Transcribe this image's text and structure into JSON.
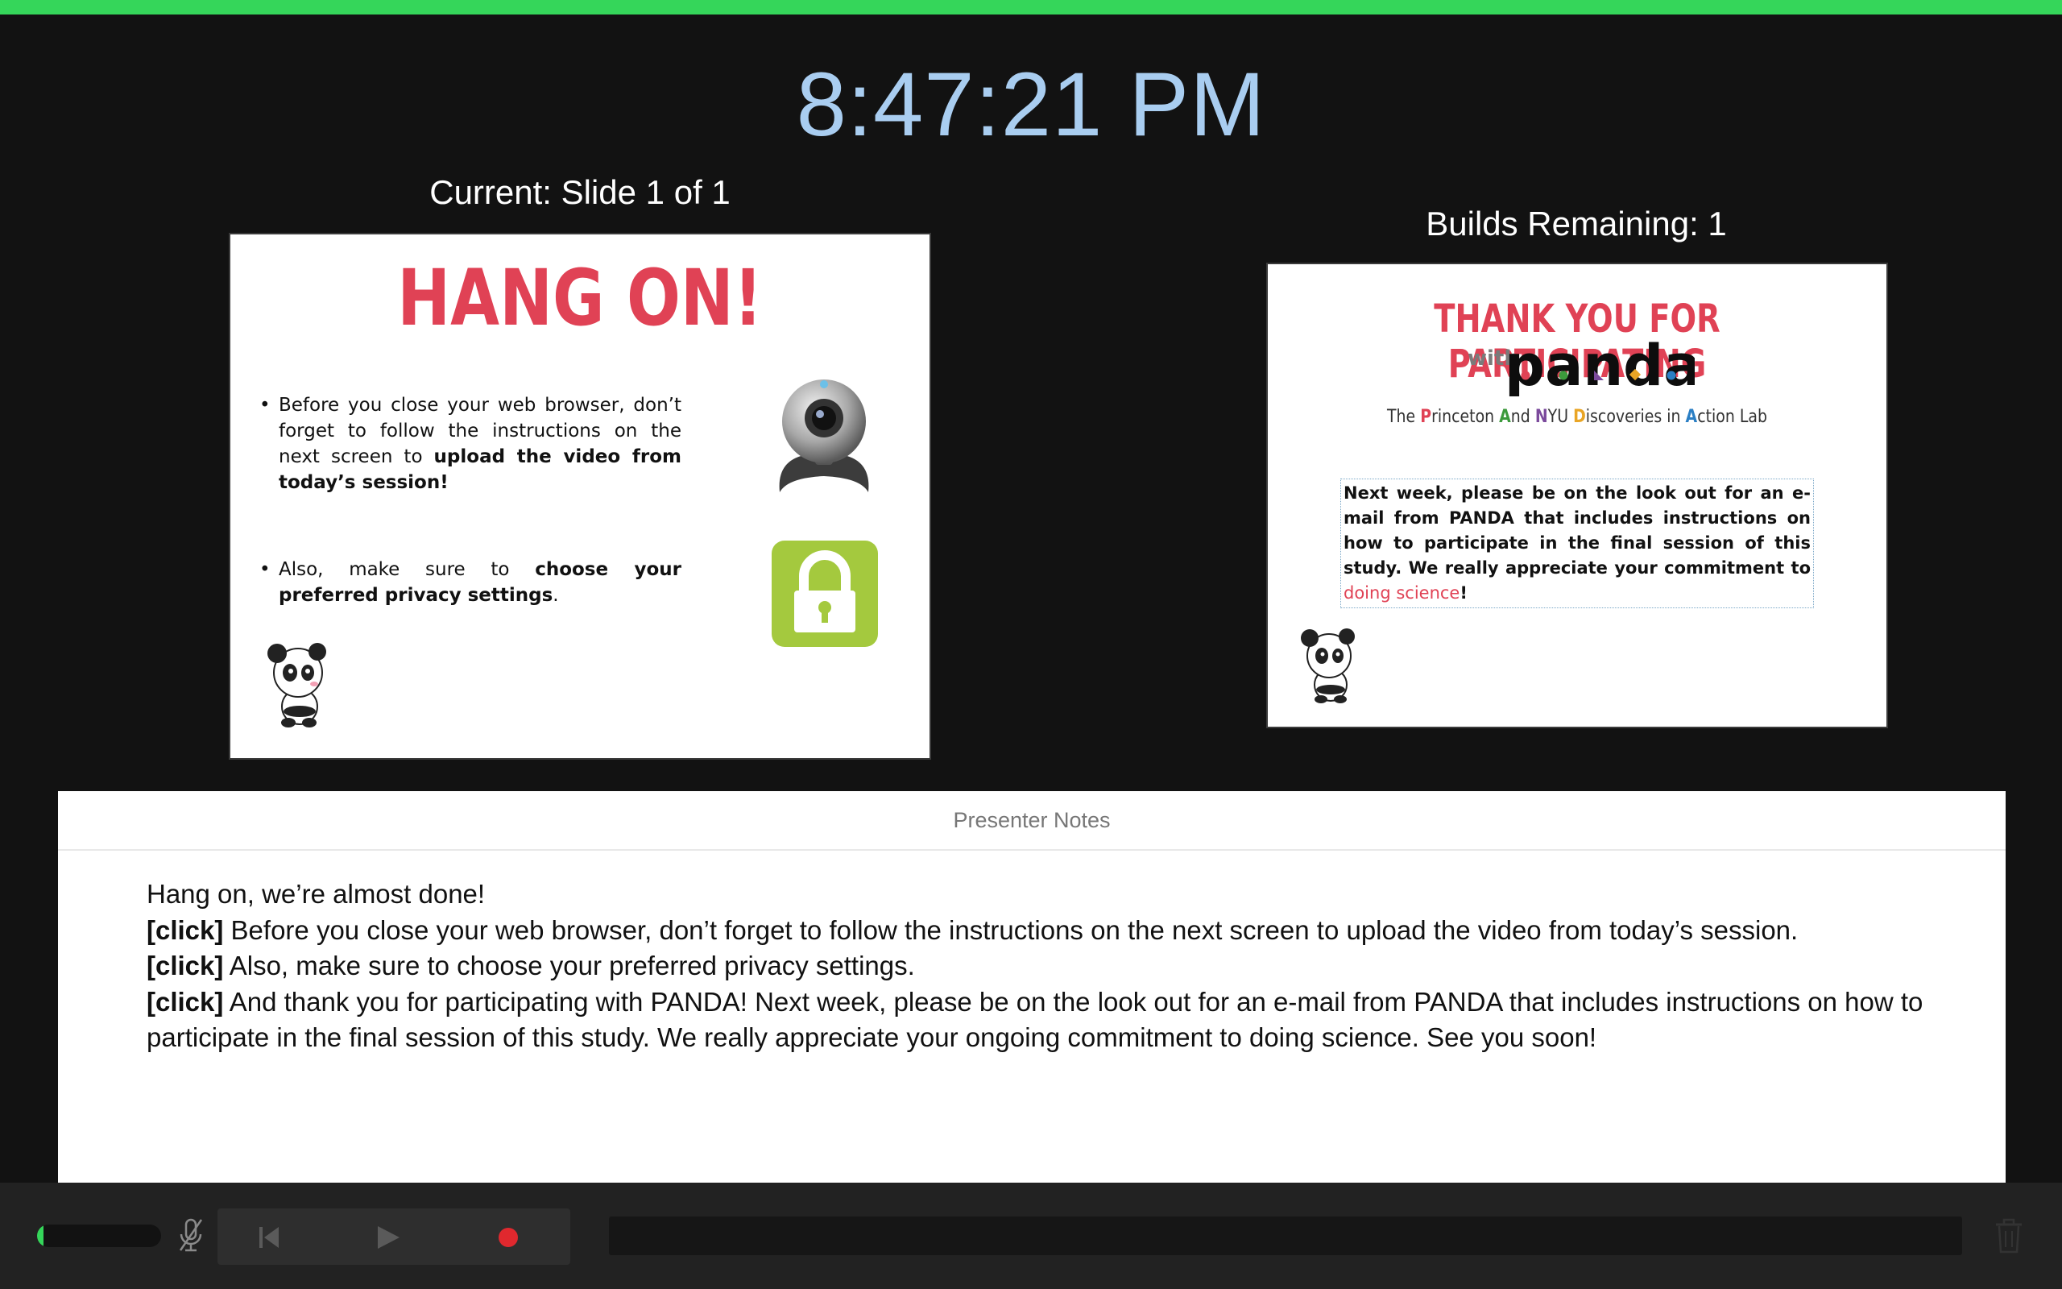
{
  "clock": "8:47:21 PM",
  "current_label": "Current: Slide 1 of 1",
  "builds_label": "Builds Remaining: 1",
  "current_slide": {
    "title": "HANG ON!",
    "bullet1_pre": "Before you close your web browser, don’t forget to follow the instructions on the next screen to ",
    "bullet1_bold": "upload the video from today’s session!",
    "bullet2_pre": "Also, make sure to ",
    "bullet2_bold": "choose your preferred privacy settings",
    "bullet2_post": ".",
    "bullet_marker": "•",
    "icons": [
      "webcam-icon",
      "lock-icon",
      "panda-icon"
    ],
    "lock_color": "#a4c93e"
  },
  "next_slide": {
    "title": "THANK YOU FOR PARTICIPATING",
    "with": "with",
    "logo_text": "panda",
    "lab_parts": {
      "the": "The ",
      "p": "P",
      "rinceton": "rinceton ",
      "a": "A",
      "nd": "nd ",
      "n": "N",
      "yu": "YU ",
      "d": "D",
      "iscoveries": "iscoveries in ",
      "a2": "A",
      "ction": "ction Lab"
    },
    "body_pre": "Next week, please be on the look out for an e-mail from PANDA that includes instructions on how to participate in the final session of this study. We really appreciate your commitment to ",
    "body_red": "doing science",
    "body_post": "!"
  },
  "notes": {
    "header": "Presenter Notes",
    "line1": "Hang on, we’re almost done!",
    "click": "[click]",
    "line2": " Before you close your web browser, don’t forget to follow the instructions on the next screen to upload the video from today’s session.",
    "line3": " Also, make sure to choose your preferred privacy settings.",
    "line4": " And thank you for participating with PANDA! Next week, please be on the look out for an e-mail from PANDA that includes instructions on how to participate in the final session of this study. We really appreciate your ongoing commitment to doing science. See you soon!"
  },
  "controls": {
    "audio_level": 0.05,
    "icons": [
      "mic-muted-icon",
      "previous-icon",
      "play-icon",
      "record-icon",
      "trash-icon"
    ],
    "accent": "#35d65a",
    "record_color": "#e0282e"
  }
}
